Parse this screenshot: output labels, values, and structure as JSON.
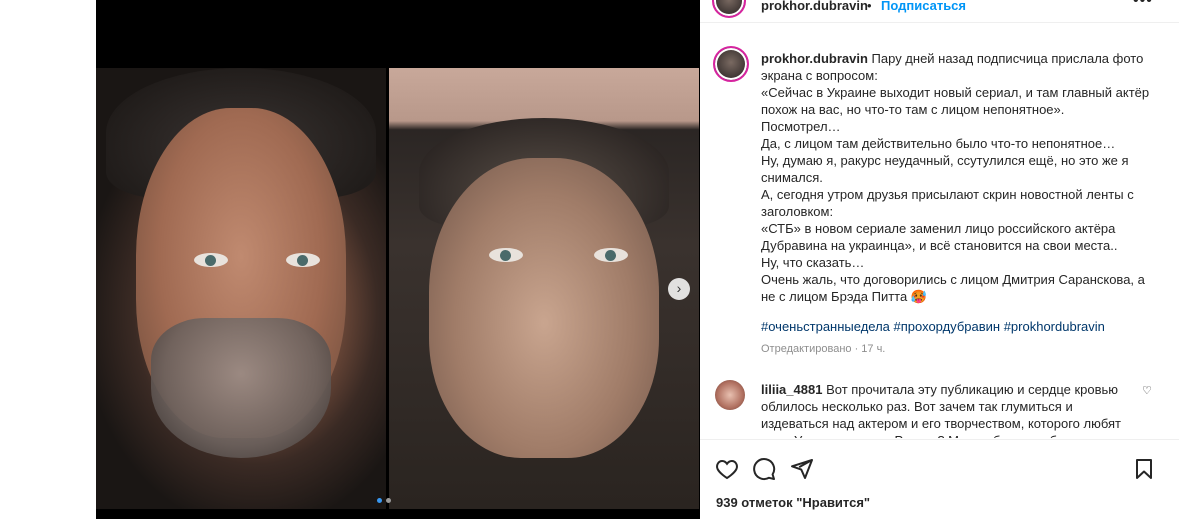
{
  "post": {
    "username": "prokhor.dubravin",
    "separator": "•",
    "follow_label": "Подписаться",
    "more_label": "•••",
    "caption_lines": [
      "Пару дней назад подписчица прислала фото экрана с вопросом:",
      "«Сейчас в Украине выходит новый сериал, и там главный актёр похож на вас, но что-то там с лицом непонятное».",
      "Посмотрел…",
      "Да, с лицом там действительно было что-то непонятное…",
      "Ну, думаю я, ракурс неудачный, ссутулился ещё, но это же я снимался.",
      "А, сегодня утром друзья присылают скрин новостной ленты с заголовком:",
      "«СТБ» в новом сериале заменил лицо российского актёра Дубравина на украинца», и всё становится на свои места..",
      "Ну, что сказать…",
      "Очень жаль, что договорились с лицом Дмитрия Саранскова, а не с лицом Брэда Питта 🥵"
    ],
    "hashtags": "#оченьстранныедела #прохордубравин #prokhordubravin",
    "meta": "Отредактировано · 17 ч."
  },
  "comment": {
    "username": "liliia_4881",
    "text": "Вот прочитала эту публикацию и сердце кровью облилось несколько раз. Вот зачем так глумиться и издеваться над актером и его творчеством, которого любят как в Украине, так и в России? Можно было вообще не"
  },
  "actions": {
    "likes": "939 отметок \"Нравится\"",
    "icons": [
      "heart-icon",
      "comment-icon",
      "share-icon",
      "bookmark-icon"
    ]
  },
  "media": {
    "next_label": "›",
    "slide_count": 2,
    "active_slide": 1
  },
  "colors": {
    "link": "#0095f6",
    "hashtag": "#00376b",
    "muted": "#8e8e8e",
    "text": "#262626"
  }
}
